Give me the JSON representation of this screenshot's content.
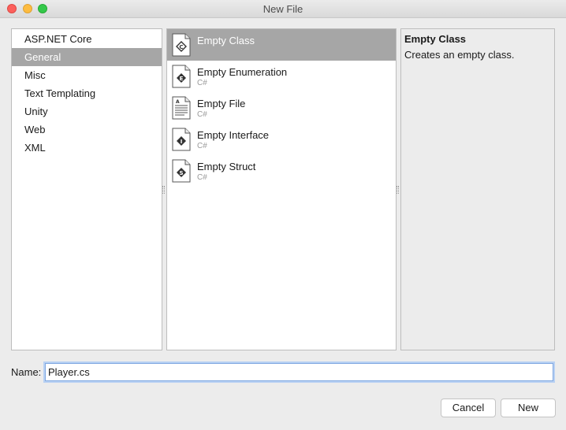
{
  "window": {
    "title": "New File"
  },
  "categories": [
    {
      "label": "ASP.NET Core",
      "selected": false
    },
    {
      "label": "General",
      "selected": true
    },
    {
      "label": "Misc",
      "selected": false
    },
    {
      "label": "Text Templating",
      "selected": false
    },
    {
      "label": "Unity",
      "selected": false
    },
    {
      "label": "Web",
      "selected": false
    },
    {
      "label": "XML",
      "selected": false
    }
  ],
  "templates": [
    {
      "name": "Empty Class",
      "language": "",
      "icon": "class-file-icon",
      "selected": true
    },
    {
      "name": "Empty Enumeration",
      "language": "C#",
      "icon": "enum-file-icon",
      "selected": false
    },
    {
      "name": "Empty File",
      "language": "C#",
      "icon": "text-file-icon",
      "selected": false
    },
    {
      "name": "Empty Interface",
      "language": "C#",
      "icon": "interface-file-icon",
      "selected": false
    },
    {
      "name": "Empty Struct",
      "language": "C#",
      "icon": "struct-file-icon",
      "selected": false
    }
  ],
  "description": {
    "title": "Empty Class",
    "text": "Creates an empty class."
  },
  "name_field": {
    "label": "Name:",
    "value": "Player.cs"
  },
  "buttons": {
    "cancel": "Cancel",
    "new": "New"
  },
  "colors": {
    "selection": "#a6a6a6",
    "focus_ring": "#b8d1f3"
  }
}
